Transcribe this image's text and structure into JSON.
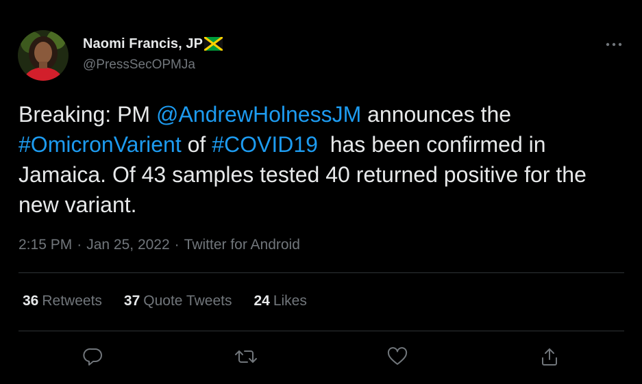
{
  "author": {
    "display_name": "Naomi Francis, JP",
    "handle": "@PressSecOPMJa",
    "flag_icon": "jamaica-flag-icon",
    "verified_flag_colors": {
      "green": "#009b3a",
      "yellow": "#fed100",
      "black": "#000000"
    }
  },
  "tweet": {
    "part1": "Breaking: PM ",
    "mention": "@AndrewHolnessJM",
    "part2": " announces the ",
    "hashtag1": "#OmicronVarient",
    "part3": " of ",
    "hashtag2": "#COVID19",
    "part4": "  has been confirmed in Jamaica. Of 43 samples tested 40 returned positive for the new variant."
  },
  "meta": {
    "time": "2:15 PM",
    "separator": "·",
    "date": "Jan 25, 2022",
    "source": "Twitter for Android"
  },
  "stats": {
    "retweets_count": "36",
    "retweets_label": "Retweets",
    "quote_count": "37",
    "quote_label": "Quote Tweets",
    "likes_count": "24",
    "likes_label": "Likes"
  },
  "icons": {
    "more": "more-icon",
    "reply": "reply-icon",
    "retweet": "retweet-icon",
    "like": "heart-icon",
    "share": "share-icon"
  },
  "colors": {
    "background": "#000000",
    "text": "#e7e9ea",
    "secondary": "#71767b",
    "link": "#1d9bf0",
    "divider": "#2f3336"
  }
}
